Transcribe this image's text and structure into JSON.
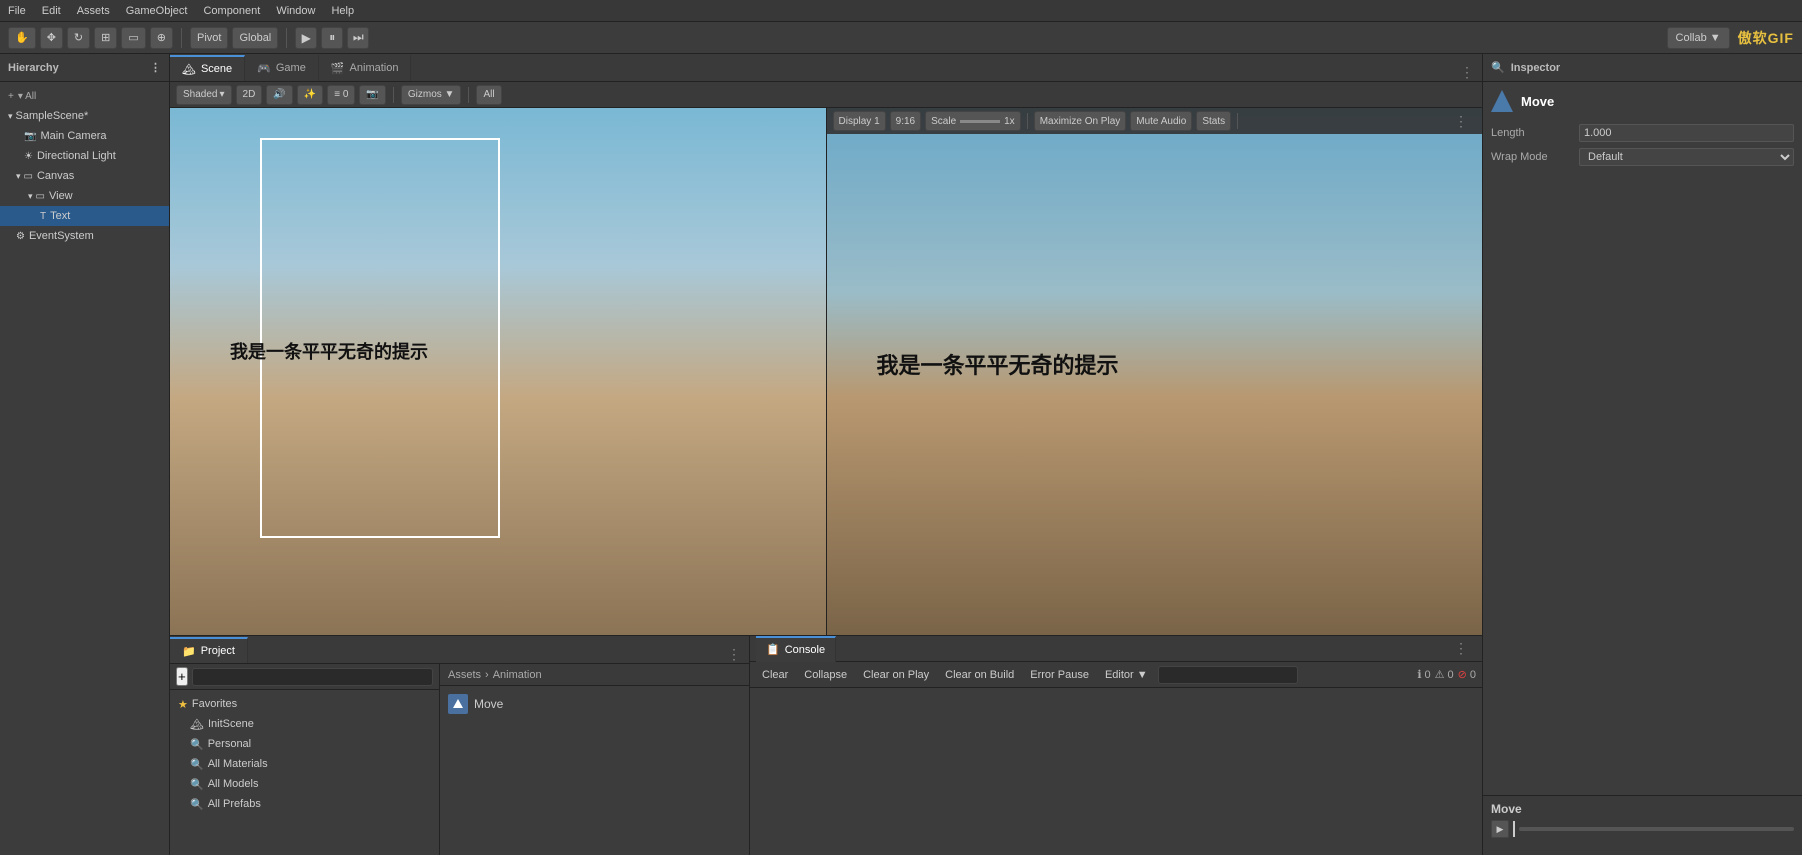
{
  "menu": {
    "items": [
      "File",
      "Edit",
      "Assets",
      "GameObject",
      "Component",
      "Window",
      "Help"
    ]
  },
  "toolbar": {
    "pivot_label": "Pivot",
    "global_label": "Global",
    "collab_label": "Collab ▼",
    "watermark": "傲软GIF"
  },
  "hierarchy": {
    "title": "Hierarchy",
    "scene_name": "SampleScene*",
    "items": [
      {
        "label": "Main Camera",
        "depth": 1
      },
      {
        "label": "Directional Light",
        "depth": 1
      },
      {
        "label": "Canvas",
        "depth": 1
      },
      {
        "label": "View",
        "depth": 2
      },
      {
        "label": "Text",
        "depth": 3
      },
      {
        "label": "EventSystem",
        "depth": 1
      }
    ]
  },
  "scene_tab": {
    "label": "Scene",
    "shading_label": "Shaded",
    "mode_2d": "2D",
    "gizmos_label": "Gizmos ▼",
    "all_label": "All"
  },
  "game_tab": {
    "label": "Game",
    "display_label": "Display 1",
    "ratio": "9:16",
    "scale_label": "Scale",
    "scale_value": "1x",
    "maximize_label": "Maximize On Play",
    "mute_label": "Mute Audio",
    "stats_label": "Stats"
  },
  "animation_tab": {
    "label": "Animation"
  },
  "chinese_text": "我是一条平平无奇的提示",
  "inspector": {
    "title": "Inspector",
    "component_name": "Move",
    "length_label": "Length",
    "length_value": "1.000",
    "wrap_mode_label": "Wrap Mode",
    "wrap_mode_value": "Default"
  },
  "project": {
    "title": "Project",
    "search_placeholder": "",
    "favorites_label": "Favorites",
    "init_scene_label": "InitScene",
    "personal_label": "Personal",
    "all_materials_label": "All Materials",
    "all_models_label": "All Models",
    "all_prefabs_label": "All Prefabs"
  },
  "breadcrumb": {
    "assets_label": "Assets",
    "animation_label": "Animation"
  },
  "asset_items": [
    {
      "label": "Move"
    }
  ],
  "console": {
    "title": "Console",
    "clear_label": "Clear",
    "collapse_label": "Collapse",
    "clear_on_play_label": "Clear on Play",
    "clear_on_build_label": "Clear on Build",
    "error_pause_label": "Error Pause",
    "editor_label": "Editor ▼",
    "count_0": "0",
    "count_1": "0",
    "count_2": "0"
  },
  "inspector_bottom": {
    "move_label": "Move"
  }
}
